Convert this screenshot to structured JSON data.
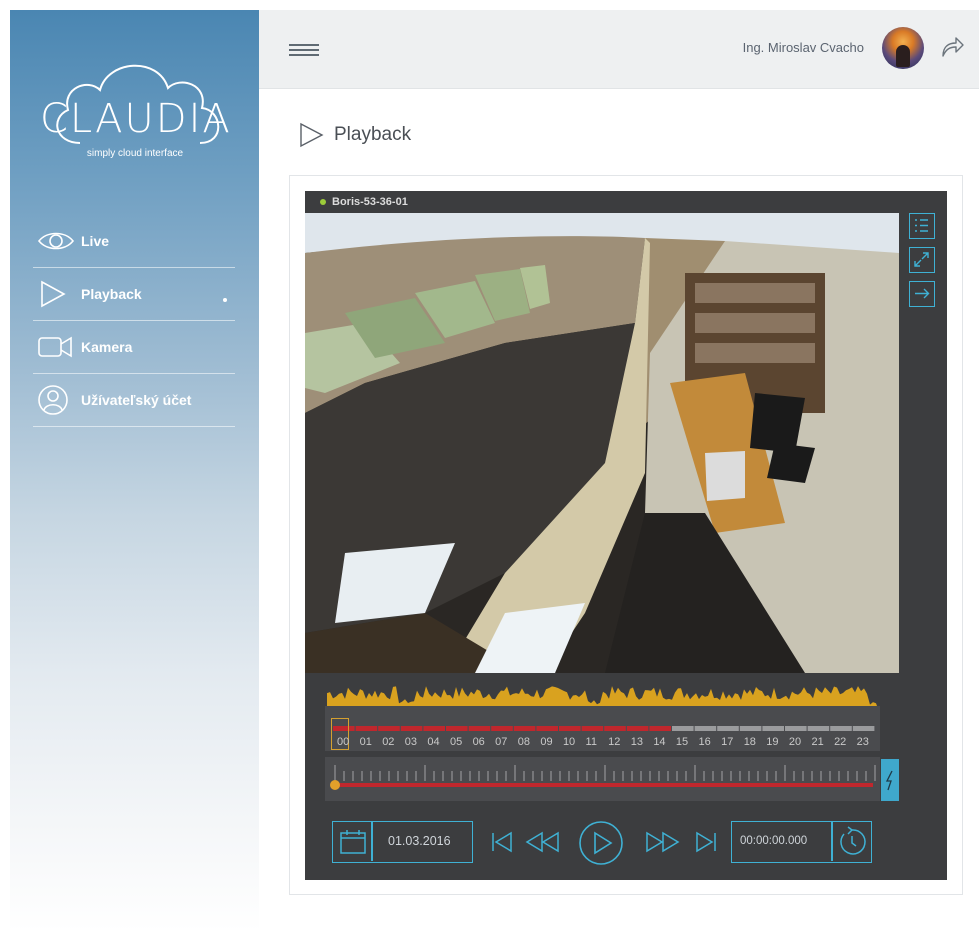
{
  "app": {
    "brand": "CLAUDIA",
    "tagline": "simply cloud interface"
  },
  "sidebar": {
    "items": [
      {
        "label": "Live",
        "icon": "eye-icon",
        "active": false
      },
      {
        "label": "Playback",
        "icon": "play-icon",
        "active": true
      },
      {
        "label": "Kamera",
        "icon": "camera-icon",
        "active": false
      },
      {
        "label": "Užívateľský účet",
        "icon": "user-icon",
        "active": false
      }
    ]
  },
  "header": {
    "user_name": "Ing. Miroslav Cvacho",
    "menu_icon": "hamburger-icon",
    "logout_icon": "share-arrow-icon"
  },
  "page": {
    "title": "Playback",
    "title_icon": "play-icon"
  },
  "player": {
    "camera_name": "Boris-53-36-01",
    "status_color": "#9ccc3a",
    "side_tools": [
      "list-icon",
      "fullscreen-icon",
      "exit-icon"
    ],
    "hours": [
      "00",
      "01",
      "02",
      "03",
      "04",
      "05",
      "06",
      "07",
      "08",
      "09",
      "10",
      "11",
      "12",
      "13",
      "14",
      "15",
      "16",
      "17",
      "18",
      "19",
      "20",
      "21",
      "22",
      "23"
    ],
    "recorded_until_hour": 15,
    "selected_hour": "00",
    "date": "01.03.2016",
    "time": "00:00:00.000",
    "accent_color": "#3fb1d4",
    "record_color": "#c0272d",
    "activity_color": "#d9a21f"
  }
}
